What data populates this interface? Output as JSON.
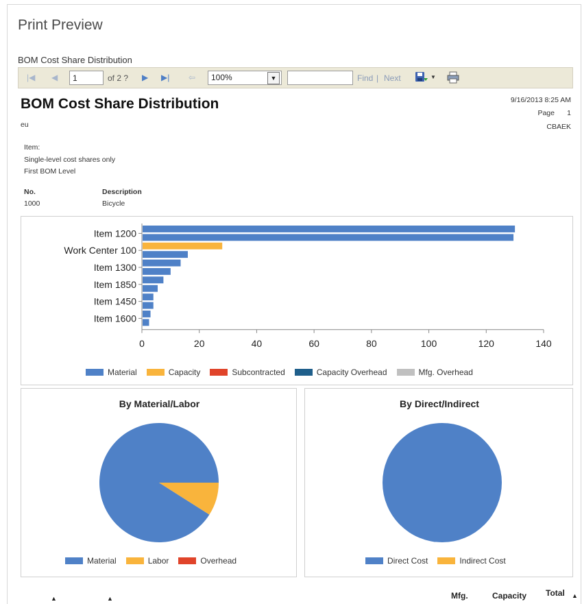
{
  "window": {
    "title": "Print Preview"
  },
  "report_name": "BOM Cost Share Distribution",
  "toolbar": {
    "page_value": "1",
    "page_of": "of 2 ?",
    "zoom": "100%",
    "find_value": "",
    "find_label": "Find",
    "separator": "|",
    "next_label": "Next"
  },
  "report": {
    "title": "BOM Cost Share Distribution",
    "company": "eu",
    "datetime": "9/16/2013 8:25 AM",
    "page_label": "Page",
    "page_number": "1",
    "user": "CBAEK",
    "filter_lines": [
      "Item:",
      "Single-level cost shares only",
      "First BOM Level"
    ],
    "no_header": "No.",
    "description_header": "Description",
    "no_value": "1000",
    "description_value": "Bicycle"
  },
  "colors": {
    "material": "#4f81c7",
    "capacity": "#f9b43c",
    "subcontracted": "#e0442a",
    "capacity_overhead": "#1f5f8b",
    "mfg_overhead": "#c0c0c0"
  },
  "chart_data": [
    {
      "type": "bar",
      "orientation": "horizontal",
      "categories": [
        "Item 1200",
        "Work Center 100",
        "Item 1300",
        "Item 1850",
        "Item 1450",
        "Item 1600"
      ],
      "bars": [
        {
          "value": 130,
          "series": "Material"
        },
        {
          "value": 129.5,
          "series": "Material"
        },
        {
          "value": 28,
          "series": "Capacity"
        },
        {
          "value": 16,
          "series": "Material"
        },
        {
          "value": 13.5,
          "series": "Material"
        },
        {
          "value": 10,
          "series": "Material"
        },
        {
          "value": 7.5,
          "series": "Material"
        },
        {
          "value": 5.5,
          "series": "Material"
        },
        {
          "value": 4,
          "series": "Material"
        },
        {
          "value": 4,
          "series": "Material"
        },
        {
          "value": 3,
          "series": "Material"
        },
        {
          "value": 2.5,
          "series": "Material"
        }
      ],
      "xlim": [
        0,
        140
      ],
      "xticks": [
        0,
        20,
        40,
        60,
        80,
        100,
        120,
        140
      ],
      "legend": [
        "Material",
        "Capacity",
        "Subcontracted",
        "Capacity Overhead",
        "Mfg. Overhead"
      ],
      "legend_position": "bottom"
    },
    {
      "type": "pie",
      "title": "By Material/Labor",
      "labels": [
        "Material",
        "Labor",
        "Overhead"
      ],
      "values": [
        91,
        9,
        0
      ],
      "legend_position": "bottom"
    },
    {
      "type": "pie",
      "title": "By Direct/Indirect",
      "labels": [
        "Direct Cost",
        "Indirect Cost"
      ],
      "values": [
        100,
        0
      ],
      "legend_position": "bottom"
    }
  ],
  "table_header": {
    "mfg": "Mfg.",
    "capacity": "Capacity",
    "total": "Total"
  }
}
